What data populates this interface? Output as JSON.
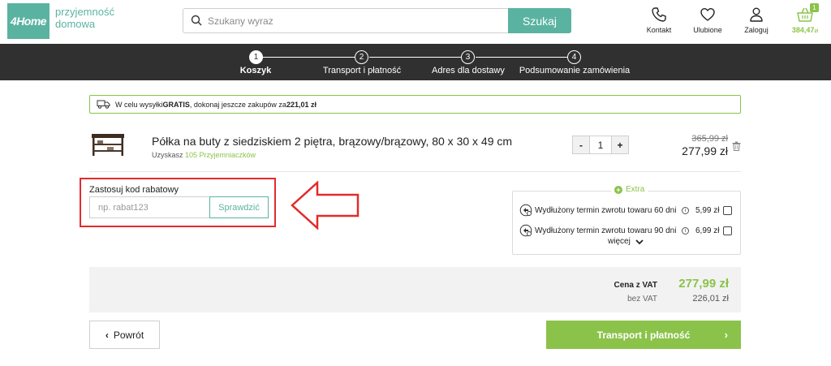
{
  "header": {
    "logo_text": "4Home",
    "tagline_line1": "przyjemność",
    "tagline_line2": "domowa",
    "search_placeholder": "Szukany wyraz",
    "search_button": "Szukaj",
    "contact_label": "Kontakt",
    "favorites_label": "Ulubione",
    "login_label": "Zaloguj",
    "cart_count": "1",
    "cart_amount": "384,47",
    "cart_currency": "zł"
  },
  "steps": [
    {
      "number": "1",
      "label": "Koszyk",
      "active": true
    },
    {
      "number": "2",
      "label": "Transport i płatność",
      "active": false
    },
    {
      "number": "3",
      "label": "Adres dla dostawy",
      "active": false
    },
    {
      "number": "4",
      "label": "Podsumowanie zamówienia",
      "active": false
    }
  ],
  "notice": {
    "prefix": "W celu wysyłki ",
    "bold1": "GRATIS",
    "middle": ", dokonaj jeszcze zakupów za ",
    "bold2": "221,01 zł"
  },
  "product": {
    "title": "Półka na buty z siedziskiem 2 piętra, brązowy/brązowy, 80 x 30 x 49 cm",
    "points_prefix": "Uzyskasz ",
    "points_value": "105 Przyjemniaczków",
    "qty_minus": "-",
    "qty_value": "1",
    "qty_plus": "+",
    "price_old": "365,99 zł",
    "price_new": "277,99 zł"
  },
  "discount": {
    "label": "Zastosuj kod rabatowy",
    "placeholder": "np. rabat123",
    "button": "Sprawdzić"
  },
  "extra": {
    "heading": "Extra",
    "items": [
      {
        "text": "Wydłużony termin zwrotu towaru 60 dni",
        "price": "5,99 zł",
        "checked": false
      },
      {
        "text": "Wydłużony termin zwrotu towaru 90 dni",
        "price": "6,99 zł",
        "checked": false
      }
    ],
    "more_label": "więcej"
  },
  "summary": {
    "vat_label": "Cena z VAT",
    "vat_value": "277,99 zł",
    "novat_label": "bez VAT",
    "novat_value": "226,01 zł"
  },
  "buttons": {
    "back": "Powrót",
    "next": "Transport i płatność"
  },
  "colors": {
    "brand_teal": "#5ab3a1",
    "accent_green": "#8bc34a",
    "steps_bar": "#303030",
    "highlight_red": "#e32b2b"
  }
}
